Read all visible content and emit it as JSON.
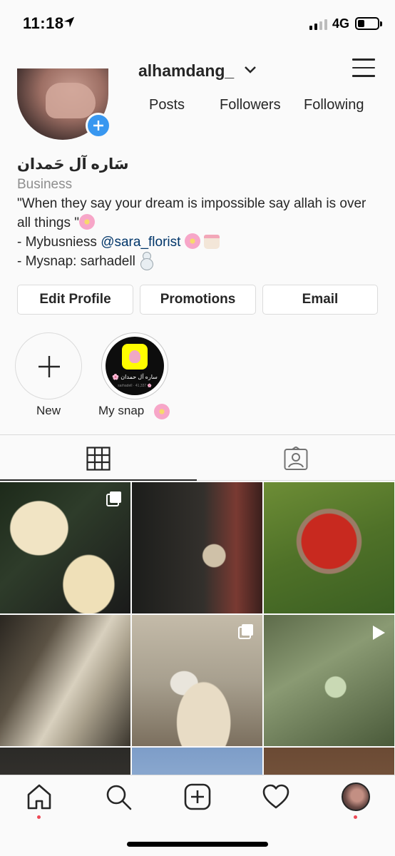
{
  "status_bar": {
    "time": "11:18",
    "network": "4G"
  },
  "header": {
    "username": "alhamdang_"
  },
  "profile": {
    "full_name": "سَاره آل حَمدان",
    "category": "Business",
    "stats": [
      {
        "label": "Posts"
      },
      {
        "label": "Followers"
      },
      {
        "label": "Following"
      }
    ],
    "bio": {
      "line1": "\"When they say your dream is impossible say allah is over all things \"",
      "line2_prefix": "- Mybusniess ",
      "line2_mention": "@sara_florist",
      "line3": "- Mysnap: sarhadell"
    }
  },
  "actions": {
    "edit_profile": "Edit Profile",
    "promotions": "Promotions",
    "email": "Email"
  },
  "highlights": [
    {
      "label": "New",
      "icon": "plus-icon"
    },
    {
      "label": "My snap",
      "cover_title": "ساره آل حمدان 🌸",
      "cover_sub": "sarhadell · 41,337 🌸"
    }
  ],
  "tabs": [
    {
      "icon": "grid-icon",
      "active": true
    },
    {
      "icon": "tagged-icon",
      "active": false
    }
  ],
  "nav": [
    "home-icon",
    "search-icon",
    "new-post-icon",
    "activity-icon",
    "profile-avatar"
  ],
  "colors": {
    "link": "#003569",
    "badge": "#3897f0",
    "notification_dot": "#ed4956"
  }
}
